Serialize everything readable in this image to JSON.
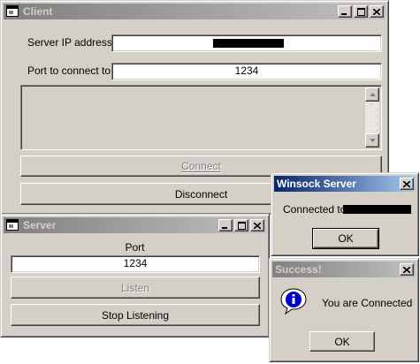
{
  "client_window": {
    "title": "Client",
    "server_ip_label": "Server IP address:",
    "server_ip_value": "",
    "port_label": "Port to connect to:",
    "port_value": "1234",
    "log_text": "",
    "connect_label": "Connect",
    "disconnect_label": "Disconnect"
  },
  "server_window": {
    "title": "Server",
    "port_label": "Port",
    "port_value": "1234",
    "listen_label": "Listen",
    "stop_label": "Stop Listening"
  },
  "winsock_dialog": {
    "title": "Winsock Server",
    "message": "Connected to",
    "ok_label": "OK"
  },
  "success_dialog": {
    "title": "Success!",
    "message": "You are Connected",
    "ok_label": "OK",
    "icon": "info-icon"
  },
  "colors": {
    "face": "#d4d0c8",
    "active_title": "#0a246a",
    "inactive_title": "#808080"
  }
}
